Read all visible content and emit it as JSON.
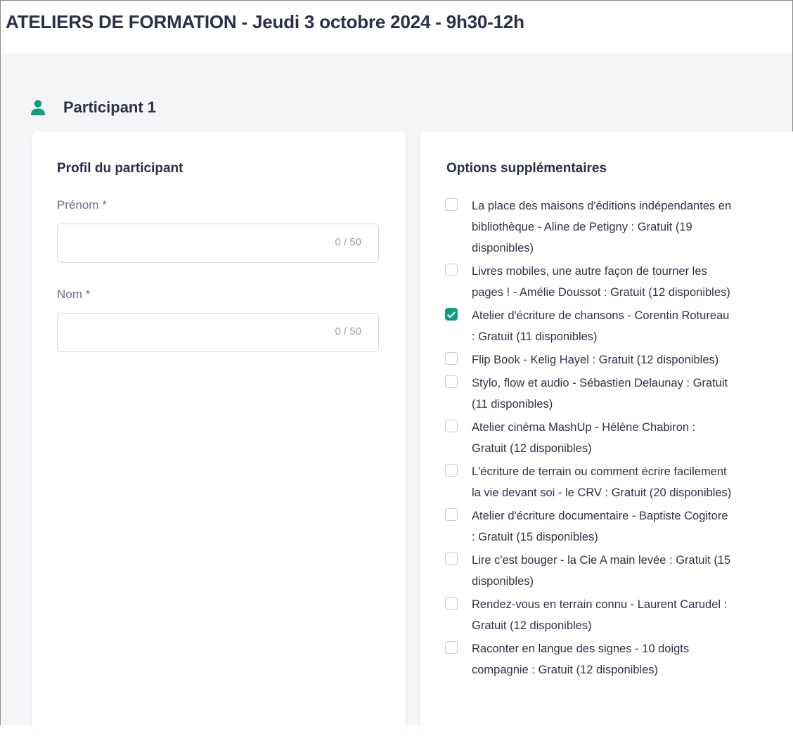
{
  "page": {
    "title": "ATELIERS DE FORMATION - Jeudi 3 octobre 2024 - 9h30-12h"
  },
  "participant": {
    "title": "Participant 1",
    "icon": "person-icon"
  },
  "profile": {
    "title": "Profil du participant",
    "fields": [
      {
        "label": "Prénom *",
        "value": "",
        "counter": "0 / 50"
      },
      {
        "label": "Nom *",
        "value": "",
        "counter": "0 / 50"
      }
    ]
  },
  "options": {
    "title": "Options supplémentaires",
    "accent_color": "#0f9d7f",
    "items": [
      {
        "label": "La place des maisons d'éditions indépendantes en bibliothèque - Aline de Petigny : Gratuit (19 disponibles)",
        "checked": false
      },
      {
        "label": "Livres mobiles, une autre façon de tourner les pages ! - Amélie Doussot : Gratuit (12 disponibles)",
        "checked": false
      },
      {
        "label": "Atelier d'écriture de chansons - Corentin Rotureau : Gratuit (11 disponibles)",
        "checked": true
      },
      {
        "label": "Flip Book - Kelig Hayel : Gratuit (12 disponibles)",
        "checked": false
      },
      {
        "label": "Stylo, flow et audio - Sébastien Delaunay : Gratuit (11 disponibles)",
        "checked": false
      },
      {
        "label": "Atelier cinéma MashUp - Hélène Chabiron : Gratuit (12 disponibles)",
        "checked": false
      },
      {
        "label": "L'écriture de terrain ou comment écrire facilement la vie devant soi - le CRV : Gratuit (20 disponibles)",
        "checked": false
      },
      {
        "label": "Atelier d'écriture documentaire - Baptiste Cogitore : Gratuit (15 disponibles)",
        "checked": false
      },
      {
        "label": "Lire c'est bouger - la Cie A main levée : Gratuit (15 disponibles)",
        "checked": false
      },
      {
        "label": "Rendez-vous en terrain connu - Laurent Carudel : Gratuit (12 disponibles)",
        "checked": false
      },
      {
        "label": "Raconter en langue des signes - 10 doigts compagnie : Gratuit (12 disponibles)",
        "checked": false
      }
    ]
  }
}
